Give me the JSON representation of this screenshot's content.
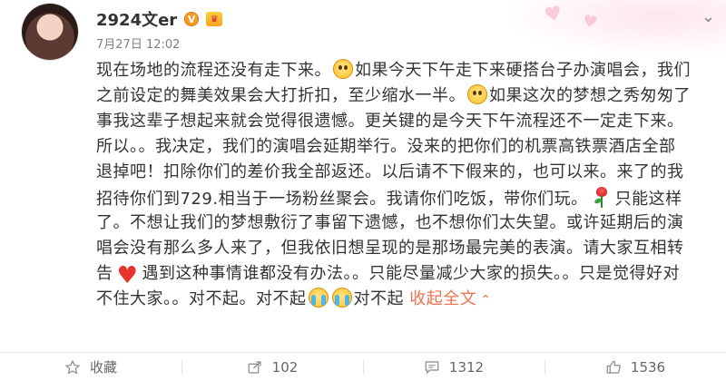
{
  "user": {
    "name": "2924文er",
    "verified_badge": "V",
    "time": "7月27日 12:02"
  },
  "post": {
    "lines": [
      [
        "现在场地的流程还没有走下来。",
        {
          "emoji": "sad"
        },
        "如果今天下午走下来硬搭台子办演唱会，我们"
      ],
      [
        "之前设定的舞美效果会大打折扣，至少缩水一半。",
        {
          "emoji": "sad"
        },
        "如果这次的梦想之秀匆匆了"
      ],
      [
        "事我这辈子想起来就会觉得很遗憾。更关键的是今天下午流程还不一定走下来。"
      ],
      [
        "所以。。我决定，我们的演唱会延期举行。没来的把你们的机票高铁票酒店全部"
      ],
      [
        "退掉吧！扣除你们的差价我全部返还。以后请不下假来的，也可以来。来了的我"
      ],
      [
        "招待你们到729.相当于一场粉丝聚会。我请你们吃饭，带你们玩。",
        {
          "emoji": "rose"
        },
        "只能这样"
      ],
      [
        "了。不想让我们的梦想敷衍了事留下遗憾，也不想你们太失望。或许延期后的演"
      ],
      [
        "唱会没有那么多人来了，但我依旧想呈现的是那场最完美的表演。请大家互相转"
      ],
      [
        "告",
        {
          "emoji": "heart"
        },
        "遇到这种事情谁都没有办法。。只能尽量减少大家的损失。。只是觉得好对"
      ],
      [
        "不住大家。。对不起。对不起",
        {
          "emoji": "cry"
        },
        {
          "emoji": "cry"
        },
        "对不起"
      ]
    ],
    "collapse_label": "收起全文",
    "collapse_arrow": "⌃"
  },
  "footer": {
    "favorite_label": "收藏",
    "share_count": "102",
    "comment_count": "1312",
    "like_count": "1536"
  },
  "colors": {
    "link": "#eb7350",
    "text": "#333333",
    "muted": "#808080"
  },
  "icons": [
    "chevron-down-icon",
    "star-icon",
    "share-icon",
    "comment-icon",
    "thumbs-up-icon",
    "vip-badge-icon"
  ]
}
